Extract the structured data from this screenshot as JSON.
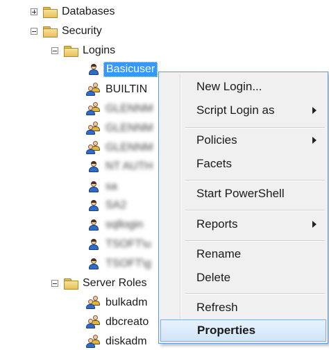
{
  "tree": {
    "databases": "Databases",
    "security": "Security",
    "logins": "Logins",
    "login_items": [
      {
        "label": "Basicuser",
        "type": "user",
        "selected": true
      },
      {
        "label": "BUILTIN",
        "type": "group"
      },
      {
        "label": "GLENNM",
        "type": "group",
        "blurred": true
      },
      {
        "label": "GLENNM",
        "type": "group",
        "blurred": true
      },
      {
        "label": "GLENNM",
        "type": "group",
        "blurred": true
      },
      {
        "label": "NT AUTH",
        "type": "user",
        "blurred": true
      },
      {
        "label": "sa",
        "type": "user",
        "blurred": true
      },
      {
        "label": "SA2",
        "type": "user",
        "blurred": true
      },
      {
        "label": "sqllogin",
        "type": "user",
        "blurred": true
      },
      {
        "label": "TSOFT\\u",
        "type": "user",
        "blurred": true
      },
      {
        "label": "TSOFT\\g",
        "type": "user",
        "blurred": true
      }
    ],
    "server_roles": "Server Roles",
    "role_items": [
      "bulkadm",
      "dbcreato",
      "diskadm"
    ]
  },
  "context_menu": {
    "items": [
      {
        "label": "New Login...",
        "submenu": false
      },
      {
        "label": "Script Login as",
        "submenu": true
      },
      {
        "label": "Policies",
        "submenu": true
      },
      {
        "label": "Facets",
        "submenu": false
      },
      {
        "label": "Start PowerShell",
        "submenu": false
      },
      {
        "label": "Reports",
        "submenu": true
      },
      {
        "label": "Rename",
        "submenu": false
      },
      {
        "label": "Delete",
        "submenu": false
      },
      {
        "label": "Refresh",
        "submenu": false
      },
      {
        "label": "Properties",
        "submenu": false,
        "highlighted": true
      }
    ]
  },
  "colors": {
    "selection": "#3399ff",
    "menu_border": "#5a9bd8",
    "menu_background": "#f0f0f0",
    "highlight": "#cfe4fa"
  }
}
